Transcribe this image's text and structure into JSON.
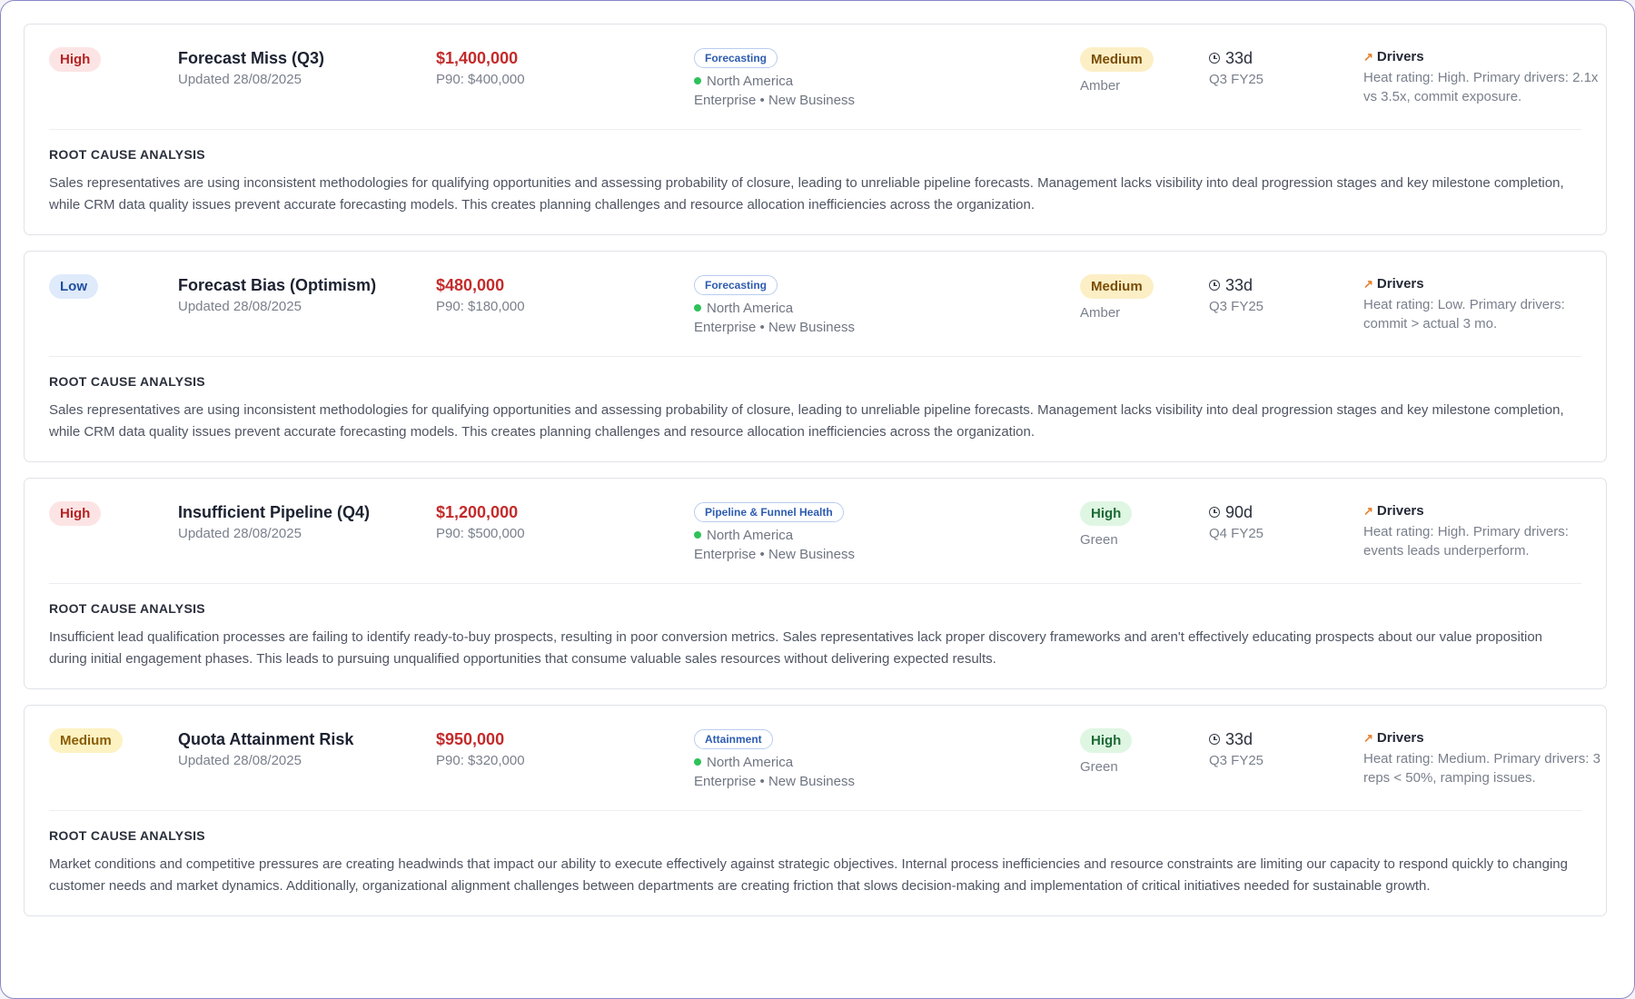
{
  "cards": [
    {
      "severity": "High",
      "severity_level": "high",
      "title": "Forecast Miss (Q3)",
      "updated": "Updated 28/08/2025",
      "amount": "$1,400,000",
      "p90": "P90: $400,000",
      "category": "Forecasting",
      "region": "North America",
      "segment": "Enterprise • New Business",
      "status": "Medium",
      "status_level": "amber",
      "status_sub": "Amber",
      "days": "33d",
      "period": "Q3 FY25",
      "drivers_label": "Drivers",
      "drivers_text": "Heat rating: High. Primary drivers: 2.1x vs 3.5x, commit exposure.",
      "rca_label": "ROOT CAUSE ANALYSIS",
      "rca_text": "Sales representatives are using inconsistent methodologies for qualifying opportunities and assessing probability of closure, leading to unreliable pipeline forecasts. Management lacks visibility into deal progression stages and key milestone completion, while CRM data quality issues prevent accurate forecasting models. This creates planning challenges and resource allocation inefficiencies across the organization."
    },
    {
      "severity": "Low",
      "severity_level": "low",
      "title": "Forecast Bias (Optimism)",
      "updated": "Updated 28/08/2025",
      "amount": "$480,000",
      "p90": "P90: $180,000",
      "category": "Forecasting",
      "region": "North America",
      "segment": "Enterprise • New Business",
      "status": "Medium",
      "status_level": "amber",
      "status_sub": "Amber",
      "days": "33d",
      "period": "Q3 FY25",
      "drivers_label": "Drivers",
      "drivers_text": "Heat rating: Low. Primary drivers: commit > actual 3 mo.",
      "rca_label": "ROOT CAUSE ANALYSIS",
      "rca_text": "Sales representatives are using inconsistent methodologies for qualifying opportunities and assessing probability of closure, leading to unreliable pipeline forecasts. Management lacks visibility into deal progression stages and key milestone completion, while CRM data quality issues prevent accurate forecasting models. This creates planning challenges and resource allocation inefficiencies across the organization."
    },
    {
      "severity": "High",
      "severity_level": "high",
      "title": "Insufficient Pipeline (Q4)",
      "updated": "Updated 28/08/2025",
      "amount": "$1,200,000",
      "p90": "P90: $500,000",
      "category": "Pipeline & Funnel Health",
      "region": "North America",
      "segment": "Enterprise • New Business",
      "status": "High",
      "status_level": "green",
      "status_sub": "Green",
      "days": "90d",
      "period": "Q4 FY25",
      "drivers_label": "Drivers",
      "drivers_text": "Heat rating: High. Primary drivers: events leads underperform.",
      "rca_label": "ROOT CAUSE ANALYSIS",
      "rca_text": "Insufficient lead qualification processes are failing to identify ready-to-buy prospects, resulting in poor conversion metrics. Sales representatives lack proper discovery frameworks and aren't effectively educating prospects about our value proposition during initial engagement phases. This leads to pursuing unqualified opportunities that consume valuable sales resources without delivering expected results."
    },
    {
      "severity": "Medium",
      "severity_level": "medium",
      "title": "Quota Attainment Risk",
      "updated": "Updated 28/08/2025",
      "amount": "$950,000",
      "p90": "P90: $320,000",
      "category": "Attainment",
      "region": "North America",
      "segment": "Enterprise • New Business",
      "status": "High",
      "status_level": "green",
      "status_sub": "Green",
      "days": "33d",
      "period": "Q3 FY25",
      "drivers_label": "Drivers",
      "drivers_text": "Heat rating: Medium. Primary drivers: 3 reps < 50%, ramping issues.",
      "rca_label": "ROOT CAUSE ANALYSIS",
      "rca_text": "Market conditions and competitive pressures are creating headwinds that impact our ability to execute effectively against strategic objectives. Internal process inefficiencies and resource constraints are limiting our capacity to respond quickly to changing customer needs and market dynamics. Additionally, organizational alignment challenges between departments are creating friction that slows decision-making and implementation of critical initiatives needed for sustainable growth."
    }
  ],
  "colors": {
    "amount": "#c42b2b",
    "region_dot": "#2ec25a",
    "trend_icon": "#e5812d",
    "frame_border": "#8a86c9"
  }
}
